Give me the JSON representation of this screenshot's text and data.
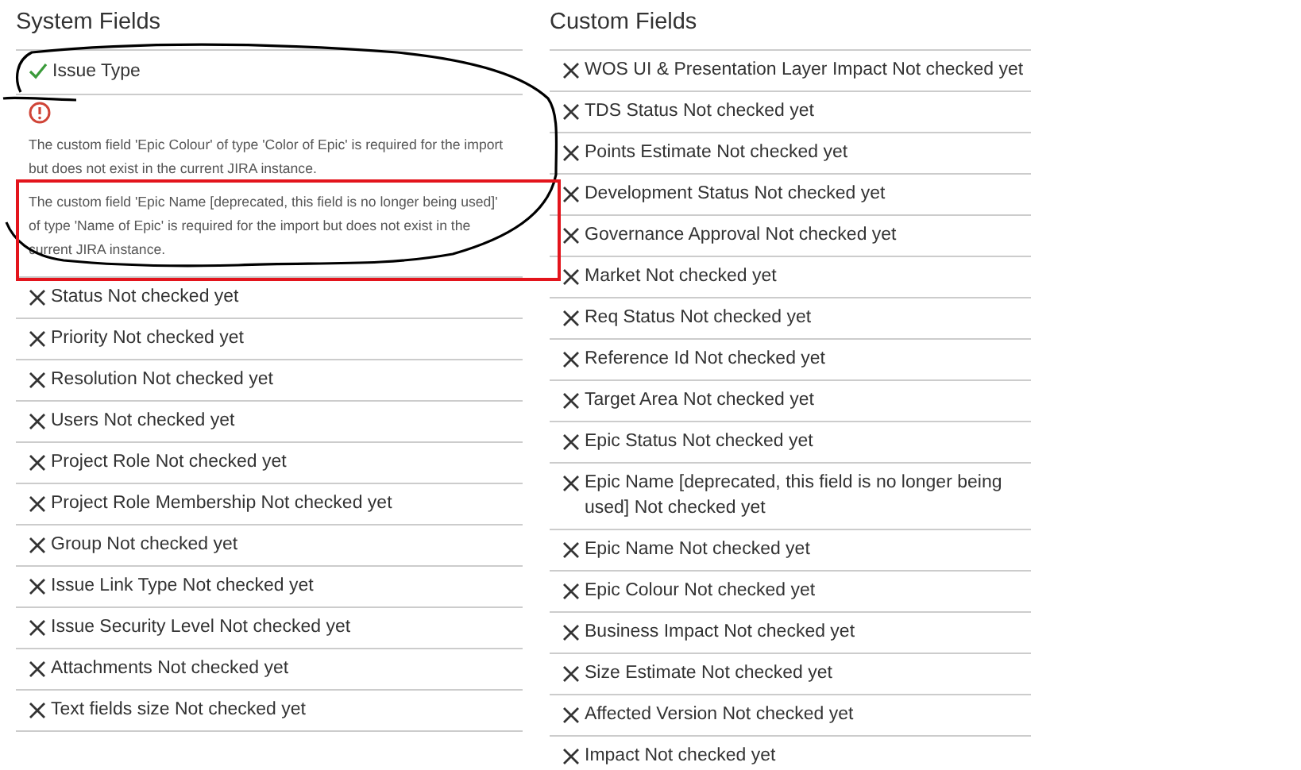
{
  "system_fields": {
    "title": "System Fields",
    "rows": [
      {
        "kind": "checked",
        "label": "Issue Type"
      },
      {
        "kind": "error",
        "messages": [
          "The custom field 'Epic Colour' of type 'Color of Epic' is required for the import but does not exist in the current JIRA instance.",
          "The custom field 'Epic Name [deprecated, this field is no longer being used]' of type 'Name of Epic' is required for the import but does not exist in the current JIRA instance."
        ]
      },
      {
        "kind": "unchecked",
        "label": "Status Not checked yet"
      },
      {
        "kind": "unchecked",
        "label": "Priority Not checked yet"
      },
      {
        "kind": "unchecked",
        "label": "Resolution Not checked yet"
      },
      {
        "kind": "unchecked",
        "label": "Users Not checked yet"
      },
      {
        "kind": "unchecked",
        "label": "Project Role Not checked yet"
      },
      {
        "kind": "unchecked",
        "label": "Project Role Membership Not checked yet"
      },
      {
        "kind": "unchecked",
        "label": "Group Not checked yet"
      },
      {
        "kind": "unchecked",
        "label": "Issue Link Type Not checked yet"
      },
      {
        "kind": "unchecked",
        "label": "Issue Security Level Not checked yet"
      },
      {
        "kind": "unchecked",
        "label": "Attachments Not checked yet"
      },
      {
        "kind": "unchecked",
        "label": "Text fields size Not checked yet"
      }
    ]
  },
  "custom_fields": {
    "title": "Custom Fields",
    "rows": [
      {
        "kind": "unchecked",
        "label": "WOS UI & Presentation Layer Impact Not checked yet"
      },
      {
        "kind": "unchecked",
        "label": "TDS Status Not checked yet"
      },
      {
        "kind": "unchecked",
        "label": "Points Estimate Not checked yet"
      },
      {
        "kind": "unchecked",
        "label": "Development Status Not checked yet"
      },
      {
        "kind": "unchecked",
        "label": "Governance Approval Not checked yet"
      },
      {
        "kind": "unchecked",
        "label": "Market Not checked yet"
      },
      {
        "kind": "unchecked",
        "label": "Req Status Not checked yet"
      },
      {
        "kind": "unchecked",
        "label": "Reference Id Not checked yet"
      },
      {
        "kind": "unchecked",
        "label": "Target Area Not checked yet"
      },
      {
        "kind": "unchecked",
        "label": "Epic Status Not checked yet"
      },
      {
        "kind": "unchecked",
        "label": "Epic Name [deprecated, this field is no longer being used] Not checked yet"
      },
      {
        "kind": "unchecked",
        "label": "Epic Name Not checked yet"
      },
      {
        "kind": "unchecked",
        "label": "Epic Colour Not checked yet"
      },
      {
        "kind": "unchecked",
        "label": "Business Impact Not checked yet"
      },
      {
        "kind": "unchecked",
        "label": "Size Estimate Not checked yet"
      },
      {
        "kind": "unchecked",
        "label": "Affected Version Not checked yet"
      },
      {
        "kind": "unchecked",
        "label": "Impact Not checked yet"
      }
    ]
  }
}
